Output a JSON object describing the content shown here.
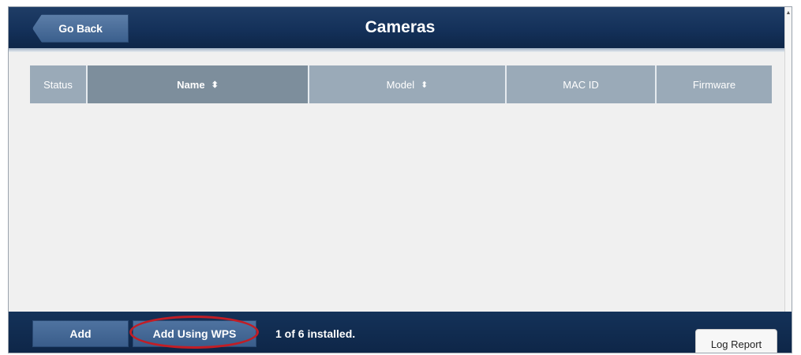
{
  "header": {
    "title": "Cameras",
    "back_label": "Go Back"
  },
  "table": {
    "columns": [
      {
        "label": "Status",
        "sort_icon": ""
      },
      {
        "label": "Name",
        "sort_icon": "⬍"
      },
      {
        "label": "Model",
        "sort_icon": "⬍"
      },
      {
        "label": "MAC ID",
        "sort_icon": ""
      },
      {
        "label": "Firmware",
        "sort_icon": ""
      }
    ],
    "active_column": "Name",
    "rows": []
  },
  "footer": {
    "add_label": "Add",
    "add_wps_label": "Add Using WPS",
    "status_text": "1 of 6 installed.",
    "log_report_label": "Log Report"
  },
  "colors": {
    "header_bg": "#14315a",
    "table_header_bg": "#9aaab8",
    "active_column_bg": "#7d8e9c",
    "highlight_ring": "#c21d25"
  }
}
